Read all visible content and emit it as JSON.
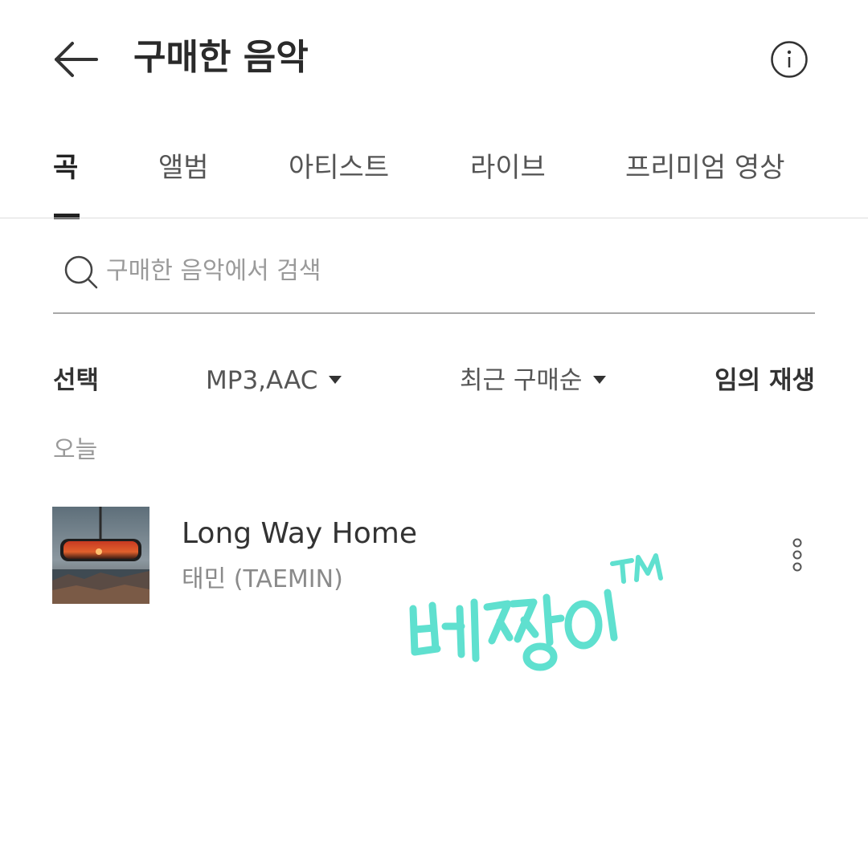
{
  "header": {
    "title": "구매한 음악",
    "back_icon": "arrow-left-icon",
    "info_icon": "info-circle-icon"
  },
  "tabs": [
    {
      "label": "곡",
      "active": true
    },
    {
      "label": "앨범",
      "active": false
    },
    {
      "label": "아티스트",
      "active": false
    },
    {
      "label": "라이브",
      "active": false
    },
    {
      "label": "프리미엄 영상",
      "active": false
    }
  ],
  "search": {
    "placeholder": "구매한 음악에서 검색",
    "value": "",
    "icon": "search-icon"
  },
  "toolbar": {
    "select_label": "선택",
    "format_value": "MP3,AAC",
    "sort_value": "최근 구매순",
    "shuffle_label": "임의 재생"
  },
  "section": {
    "label": "오늘"
  },
  "songs": [
    {
      "title": "Long Way Home",
      "artist": "태민 (TAEMIN)",
      "more_icon": "more-vertical-icon"
    }
  ],
  "colors": {
    "text_primary": "#222222",
    "text_secondary": "#8a8a8a",
    "watermark": "#5fe0cf"
  }
}
